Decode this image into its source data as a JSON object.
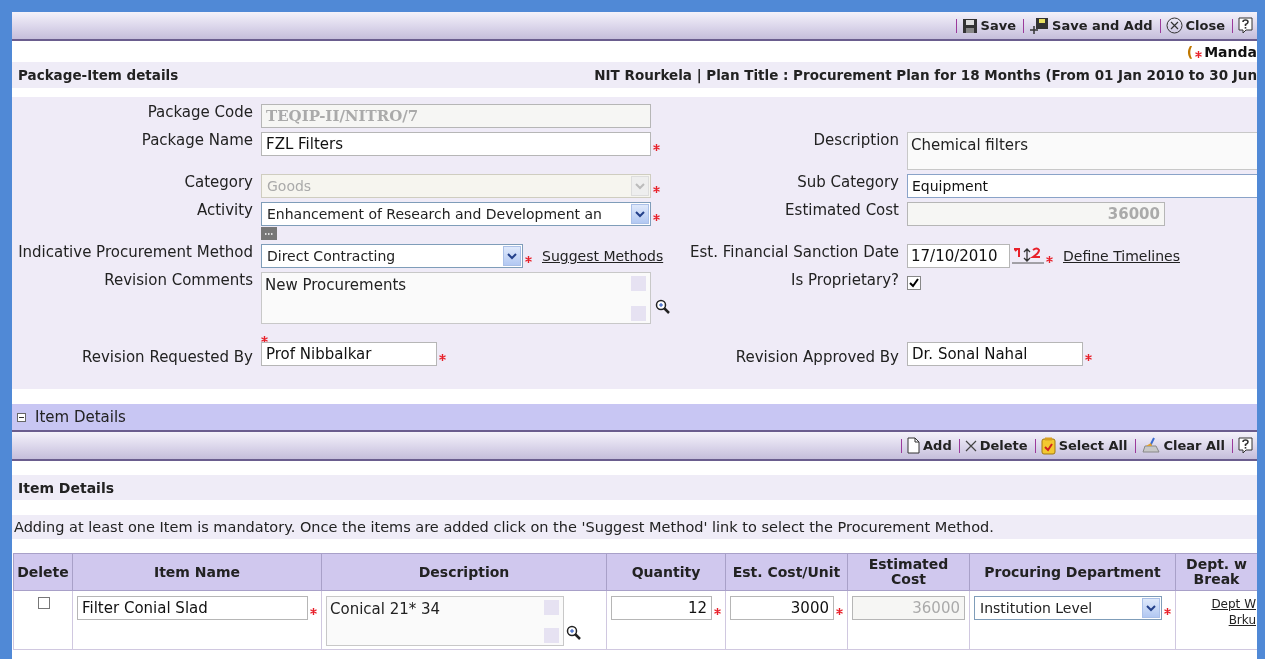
{
  "toolbar": [
    {
      "kind": "save",
      "label": "Save"
    },
    {
      "kind": "save-add",
      "label": "Save and Add"
    },
    {
      "kind": "close",
      "label": "Close"
    },
    {
      "kind": "help"
    }
  ],
  "mandatory_note": {
    "open": "(",
    "text": "Manda"
  },
  "header": {
    "title": "Package-Item details",
    "context": "NIT Rourkela | Plan Title : Procurement Plan for 18 Months (From 01 Jan 2010 to 30 Jun"
  },
  "form": {
    "rows": [
      {
        "left": {
          "label": "Package Code",
          "kind": "text",
          "value": "TEQIP-II/NITRO/7",
          "disabled": true,
          "required": false
        }
      },
      {
        "left": {
          "label": "Package Name",
          "kind": "text",
          "value": "FZL Filters",
          "disabled": false,
          "required": true
        },
        "right": {
          "label": "Description",
          "kind": "textarea",
          "value": "Chemical filters",
          "required": false
        }
      },
      {
        "left": {
          "label": "Category",
          "kind": "select",
          "value": "Goods",
          "disabled": true,
          "required": true
        },
        "right": {
          "label": "Sub Category",
          "kind": "text",
          "value": "Equipment",
          "disabled": false,
          "required": false
        }
      },
      {
        "left": {
          "label": "Activity",
          "kind": "select",
          "value": "Enhancement of Research and Development an",
          "disabled": false,
          "required": true,
          "more_button": true
        },
        "right": {
          "label": "Estimated Cost",
          "kind": "number",
          "value": "36000",
          "disabled": true,
          "required": false
        }
      },
      {
        "left": {
          "label": "Indicative Procurement Method",
          "kind": "select",
          "value": "Direct Contracting",
          "disabled": false,
          "required": true,
          "link": "Suggest Methods"
        },
        "right": {
          "label": "Est. Financial Sanction Date",
          "kind": "date",
          "value": "17/10/2010",
          "required": true,
          "link": "Define Timelines"
        }
      },
      {
        "left": {
          "label": "Revision Comments",
          "kind": "textarea",
          "value": "New Procurements",
          "required": false,
          "zoom": true
        },
        "right": {
          "label": "Is Proprietary?",
          "kind": "checkbox",
          "checked": true
        }
      },
      {
        "left": {
          "label": "Revision Requested By",
          "kind": "text",
          "value": "Prof Nibbalkar",
          "disabled": false,
          "required": true,
          "mark_above": true
        },
        "right": {
          "label": "Revision Approved By",
          "kind": "text",
          "value": "Dr. Sonal Nahal",
          "disabled": false,
          "required": true
        }
      }
    ]
  },
  "section": {
    "title": "Item Details",
    "expanded": true
  },
  "item_toolbar": [
    {
      "kind": "add",
      "label": "Add"
    },
    {
      "kind": "delete",
      "label": "Delete"
    },
    {
      "kind": "select-all",
      "label": "Select All"
    },
    {
      "kind": "clear-all",
      "label": "Clear All"
    },
    {
      "kind": "help"
    }
  ],
  "items_title": "Item Details",
  "items_note": "Adding at least one Item is mandatory. Once the items are added click on the 'Suggest Method' link to select the Procurement Method.",
  "table": {
    "columns": [
      "Delete",
      "Item Name",
      "Description",
      "Quantity",
      "Est. Cost/Unit",
      "Estimated\nCost",
      "Procuring Department",
      "Dept. w\nBreak"
    ],
    "rows": [
      {
        "checked": false,
        "item_name": "Filter Conial Slad",
        "description": "Conical 21* 34",
        "quantity": "12",
        "cost_unit": "3000",
        "estimated_cost": "36000",
        "department": "Institution Level",
        "breakup_link": "Dept W\nBrku"
      }
    ]
  }
}
